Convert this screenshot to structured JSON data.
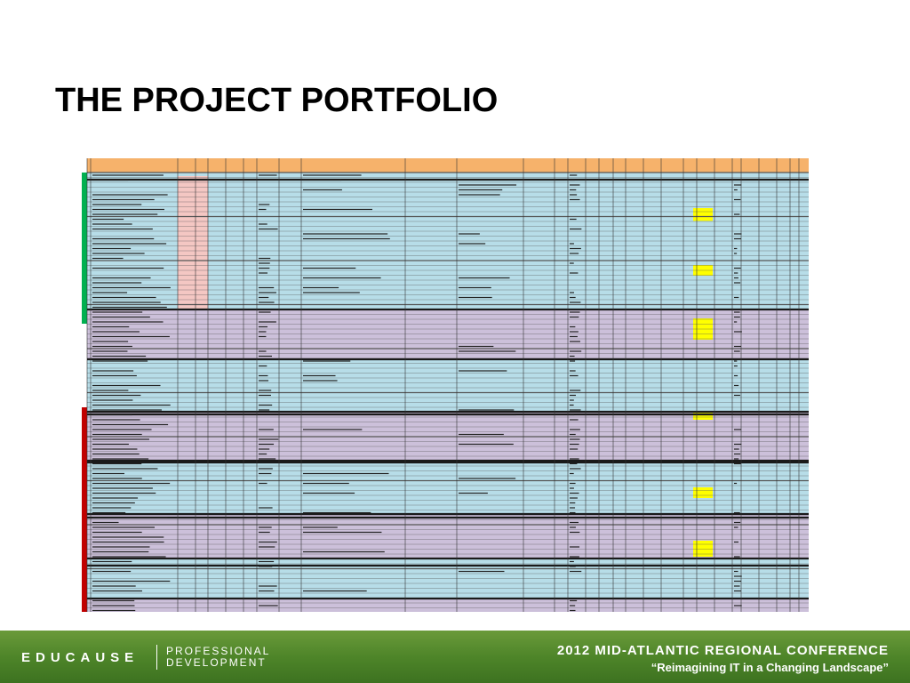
{
  "slide": {
    "title": "THE PROJECT PORTFOLIO"
  },
  "spreadsheet": {
    "image_description_note": "",
    "colors": {
      "header": "#f6b26b",
      "row_blue": "#b7dde8",
      "row_purple": "#ccc0da",
      "row_pink": "#f4c7c3",
      "gridline": "#1a1a1a",
      "highlight": "#ffff00",
      "status_green": "#00b050",
      "status_red": "#c00000"
    }
  },
  "footer": {
    "brand": "EDUCAUSE",
    "brand_sub_line1": "PROFESSIONAL",
    "brand_sub_line2": "DEVELOPMENT",
    "conference_title": "2012 MID-ATLANTIC REGIONAL CONFERENCE",
    "conference_tagline": "“Reimagining IT in a Changing Landscape”",
    "colors": {
      "band": "#4e8529",
      "text": "#ffffff"
    }
  }
}
